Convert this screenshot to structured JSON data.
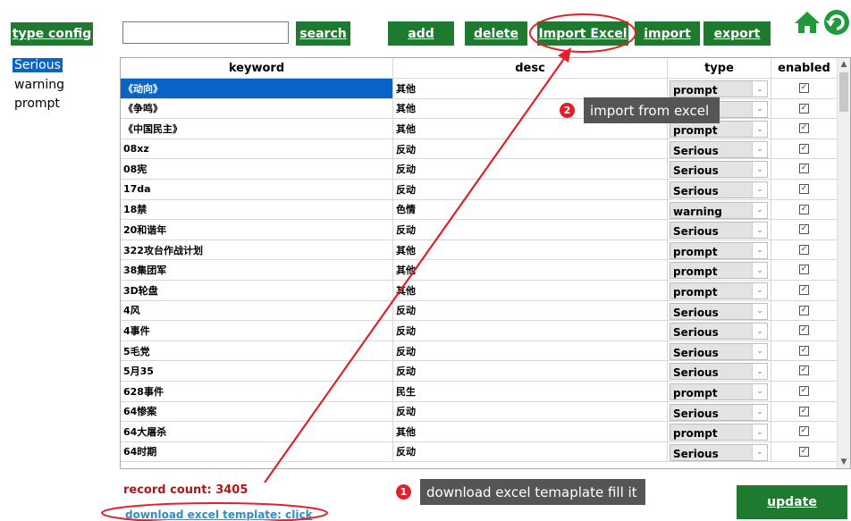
{
  "toolbar": {
    "type_config": "type config",
    "search_value": "",
    "search_label": "search",
    "add_label": "add",
    "delete_label": "delete",
    "import_excel_label": "Import Excel",
    "import_label": "import",
    "export_label": "export"
  },
  "sidebar": {
    "items": [
      {
        "label": "Serious"
      },
      {
        "label": "warning"
      },
      {
        "label": "prompt"
      }
    ]
  },
  "table": {
    "headers": [
      "keyword",
      "desc",
      "type",
      "enabled"
    ],
    "rows": [
      {
        "keyword": "《动向》",
        "desc": "其他",
        "type": "prompt"
      },
      {
        "keyword": "《争鸣》",
        "desc": "其他",
        "type": "prompt"
      },
      {
        "keyword": "《中国民主》",
        "desc": "其他",
        "type": "prompt"
      },
      {
        "keyword": "08xz",
        "desc": "反动",
        "type": "Serious"
      },
      {
        "keyword": "08宪",
        "desc": "反动",
        "type": "Serious"
      },
      {
        "keyword": "17da",
        "desc": "反动",
        "type": "Serious"
      },
      {
        "keyword": "18禁",
        "desc": "色情",
        "type": "warning"
      },
      {
        "keyword": "20和谐年",
        "desc": "反动",
        "type": "Serious"
      },
      {
        "keyword": "322攻台作战计划",
        "desc": "其他",
        "type": "prompt"
      },
      {
        "keyword": "38集团军",
        "desc": "其他",
        "type": "prompt"
      },
      {
        "keyword": "3D轮盘",
        "desc": "其他",
        "type": "prompt"
      },
      {
        "keyword": "4风",
        "desc": "反动",
        "type": "Serious"
      },
      {
        "keyword": "4事件",
        "desc": "反动",
        "type": "Serious"
      },
      {
        "keyword": "5毛党",
        "desc": "反动",
        "type": "Serious"
      },
      {
        "keyword": "5月35",
        "desc": "反动",
        "type": "Serious"
      },
      {
        "keyword": "628事件",
        "desc": "民生",
        "type": "prompt"
      },
      {
        "keyword": "64惨案",
        "desc": "反动",
        "type": "Serious"
      },
      {
        "keyword": "64大屠杀",
        "desc": "其他",
        "type": "prompt"
      },
      {
        "keyword": "64时期",
        "desc": "反动",
        "type": "Serious"
      }
    ],
    "checkbox_glyph": "✓"
  },
  "footer": {
    "record_count": "record count: 3405",
    "download_link": "download excel template: click",
    "update_label": "update"
  },
  "annotations": {
    "step1_number": "1",
    "step1_text": "download excel temaplate fill it",
    "step2_number": "2",
    "step2_text": "import from excel"
  },
  "icons": {
    "home": "home-icon",
    "refresh": "refresh-icon"
  },
  "colors": {
    "button_green": "#1e7a2e",
    "selection_blue": "#0a64c8",
    "annotation_red": "#e2202a",
    "record_red": "#b01818",
    "link_blue": "#2a8fd0"
  }
}
